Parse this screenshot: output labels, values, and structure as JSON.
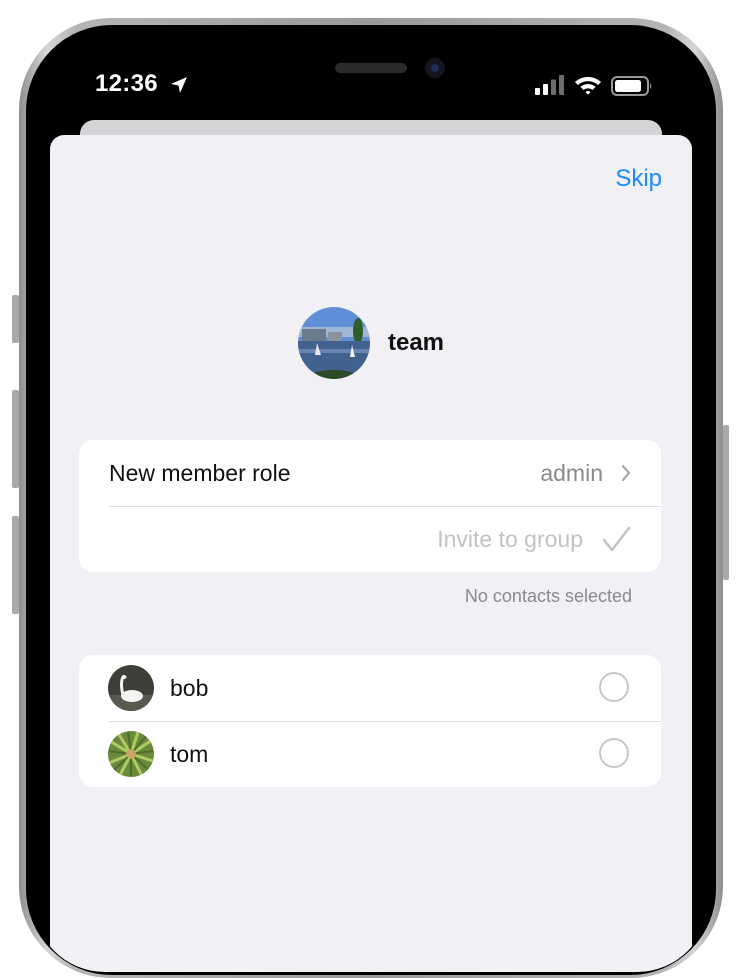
{
  "status_bar": {
    "time": "12:36",
    "icons": [
      "location-arrow-icon",
      "cellular-signal-icon",
      "wifi-icon",
      "battery-icon"
    ]
  },
  "sheet": {
    "skip_label": "Skip",
    "group": {
      "name": "team",
      "avatar": "lake-with-sailboats-photo"
    },
    "settings": {
      "role_label": "New member role",
      "role_value": "admin",
      "invite_label": "Invite to group"
    },
    "selection_note": "No contacts selected",
    "contacts": [
      {
        "name": "bob",
        "avatar": "swan-photo",
        "selected": false
      },
      {
        "name": "tom",
        "avatar": "green-plant-photo",
        "selected": false
      }
    ]
  },
  "colors": {
    "accent": "#1a8cff",
    "sheet_background": "#f0f0f5",
    "secondary_text": "#8a8a8e",
    "disabled_text": "#c2c2c6"
  }
}
